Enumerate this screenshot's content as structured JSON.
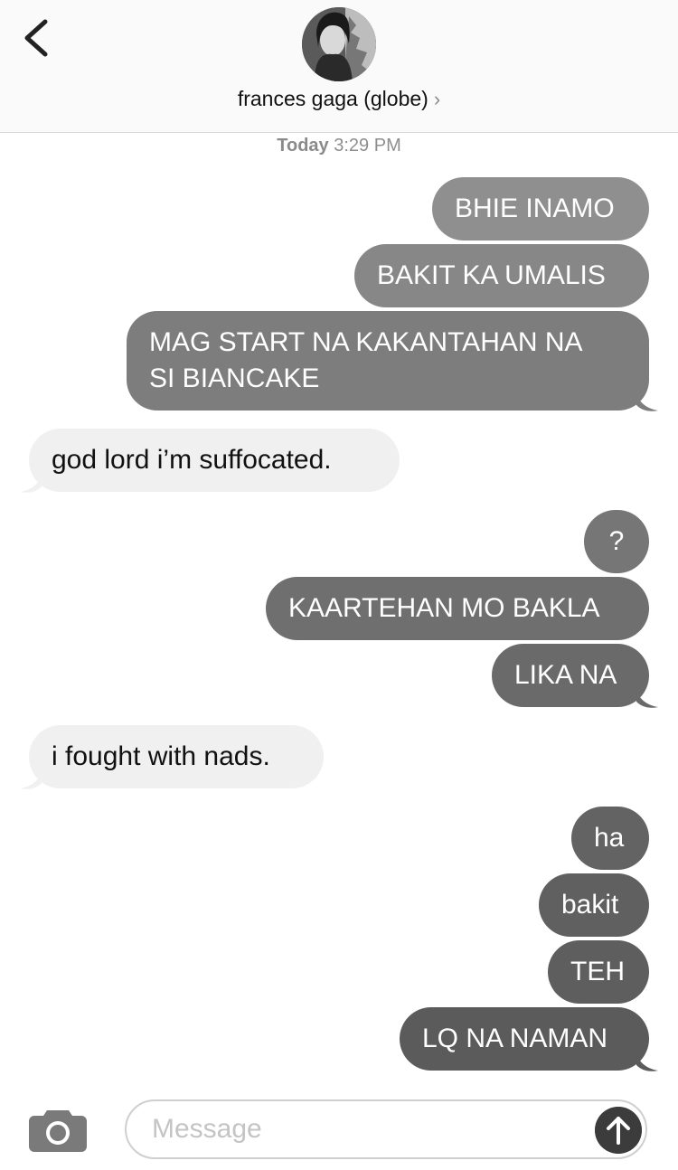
{
  "header": {
    "contact_name": "frances gaga (globe)",
    "chevron": "›",
    "back_icon": "chevron-left-icon"
  },
  "thread": {
    "timestamp_day": "Today",
    "timestamp_time": "3:29 PM",
    "messages": [
      {
        "from": "me",
        "text": "BHIE INAMO"
      },
      {
        "from": "me",
        "text": "BAKIT KA UMALIS"
      },
      {
        "from": "me",
        "lines": [
          "MAG START NA KAKANTAHAN NA",
          "SI BIANCAKE"
        ]
      },
      {
        "from": "them",
        "text": "god lord i’m suffocated."
      },
      {
        "from": "me",
        "text": "?"
      },
      {
        "from": "me",
        "text": "KAARTEHAN MO BAKLA"
      },
      {
        "from": "me",
        "text": "LIKA NA"
      },
      {
        "from": "them",
        "text": "i fought with nads."
      },
      {
        "from": "me",
        "text": "ha"
      },
      {
        "from": "me",
        "text": "bakit"
      },
      {
        "from": "me",
        "text": "TEH"
      },
      {
        "from": "me",
        "text": "LQ NA NAMAN"
      }
    ]
  },
  "composer": {
    "placeholder": "Message",
    "camera_icon": "camera-icon",
    "send_icon": "arrow-up-icon"
  },
  "colors": {
    "sent_top": "#8f8f8f",
    "sent_bottom": "#5e5e5e",
    "received": "#f0f0f0"
  }
}
